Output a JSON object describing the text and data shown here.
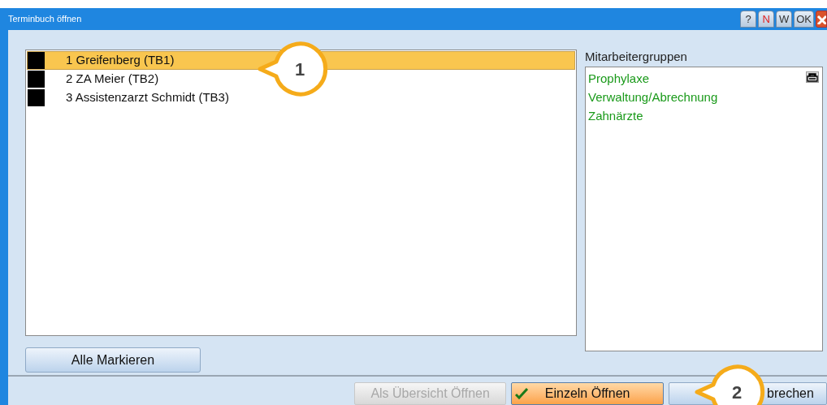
{
  "window": {
    "title": "Terminbuch öffnen"
  },
  "title_buttons": [
    {
      "kind": "text",
      "label": "?"
    },
    {
      "kind": "alert",
      "label": "N"
    },
    {
      "kind": "text",
      "label": "W"
    },
    {
      "kind": "text",
      "label": "OK"
    },
    {
      "kind": "close"
    }
  ],
  "calendars": [
    {
      "label": "1 Greifenberg (TB1)",
      "color": "#000000",
      "selected": true
    },
    {
      "label": "2 ZA Meier (TB2)",
      "color": "#000000",
      "selected": false
    },
    {
      "label": "3 Assistenzarzt Schmidt (TB3)",
      "color": "#000000",
      "selected": false
    }
  ],
  "groups": {
    "title": "Mitarbeitergruppen",
    "items": [
      "Prophylaxe",
      "Verwaltung/Abrechnung",
      "Zahnärzte"
    ]
  },
  "mark_all_button": "Alle Markieren",
  "buttons": [
    {
      "label": "Als Übersicht Öffnen",
      "kind": "plain",
      "disabled": true
    },
    {
      "label": "Einzeln Öffnen",
      "kind": "primary",
      "disabled": false
    },
    {
      "label": "brechen",
      "kind": "plain",
      "disabled": false
    }
  ],
  "callouts": [
    "1",
    "2"
  ]
}
